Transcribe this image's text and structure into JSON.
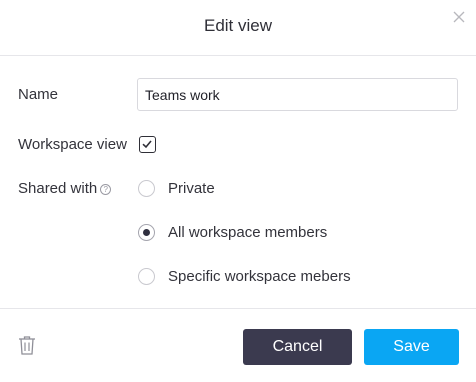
{
  "dialog": {
    "title": "Edit view",
    "close_icon": "close-icon"
  },
  "form": {
    "name_label": "Name",
    "name_value": "Teams work",
    "workspace_view_label": "Workspace view",
    "workspace_view_checked": true,
    "shared_with_label": "Shared with",
    "help_icon": "question-circle-icon",
    "sharing_options": [
      {
        "label": "Private",
        "selected": false
      },
      {
        "label": "All workspace members",
        "selected": true
      },
      {
        "label": "Specific workspace mebers",
        "selected": false
      }
    ]
  },
  "footer": {
    "delete_icon": "trash-icon",
    "cancel_label": "Cancel",
    "save_label": "Save"
  },
  "colors": {
    "cancel_bg": "#3b3a4f",
    "save_bg": "#0aa6f3",
    "radio_selected": "#2f2f3f"
  }
}
